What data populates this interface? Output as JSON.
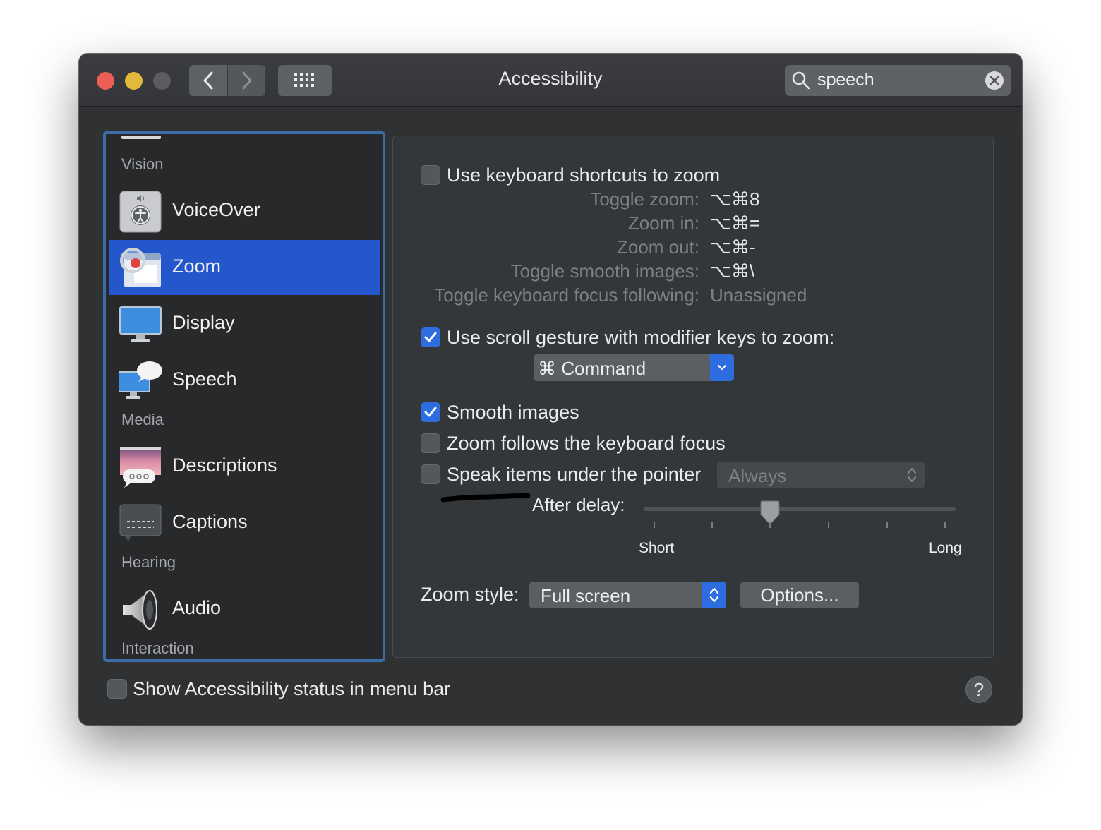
{
  "window": {
    "title": "Accessibility",
    "search": {
      "query": "speech",
      "placeholder": "Search"
    }
  },
  "sidebar": {
    "sections": {
      "vision": "Vision",
      "media": "Media",
      "hearing": "Hearing",
      "interaction": "Interaction"
    },
    "items": [
      {
        "label": "VoiceOver",
        "icon": "voiceover-icon"
      },
      {
        "label": "Zoom",
        "icon": "zoom-icon",
        "selected": true
      },
      {
        "label": "Display",
        "icon": "display-icon"
      },
      {
        "label": "Speech",
        "icon": "speech-icon"
      },
      {
        "label": "Descriptions",
        "icon": "descriptions-icon"
      },
      {
        "label": "Captions",
        "icon": "captions-icon"
      },
      {
        "label": "Audio",
        "icon": "audio-icon"
      }
    ]
  },
  "zoom": {
    "keyboard_shortcuts": {
      "label": "Use keyboard shortcuts to zoom",
      "checked": false,
      "shortcuts": [
        {
          "name": "Toggle zoom:",
          "keys": "⌥⌘8"
        },
        {
          "name": "Zoom in:",
          "keys": "⌥⌘="
        },
        {
          "name": "Zoom out:",
          "keys": "⌥⌘-"
        },
        {
          "name": "Toggle smooth images:",
          "keys": "⌥⌘\\"
        },
        {
          "name": "Toggle keyboard focus following:",
          "keys": "Unassigned"
        }
      ]
    },
    "scroll_gesture": {
      "label": "Use scroll gesture with modifier keys to zoom:",
      "checked": true,
      "modifier": "⌘ Command"
    },
    "smooth_images": {
      "label": "Smooth images",
      "checked": true
    },
    "follow_focus": {
      "label": "Zoom follows the keyboard focus",
      "checked": false
    },
    "speak_items": {
      "label": "Speak items under the pointer",
      "checked": false,
      "mode": "Always",
      "delay_label": "After delay:",
      "delay_min": "Short",
      "delay_max": "Long",
      "delay_value": 0.4
    },
    "zoom_style": {
      "label": "Zoom style:",
      "value": "Full screen",
      "options_button": "Options..."
    }
  },
  "footer": {
    "status_menu": {
      "label": "Show Accessibility status in menu bar",
      "checked": false
    },
    "help": "?"
  },
  "colors": {
    "accent": "#2e6de0",
    "selection": "#2457cc",
    "sidebar_border": "#3c6ca6"
  }
}
